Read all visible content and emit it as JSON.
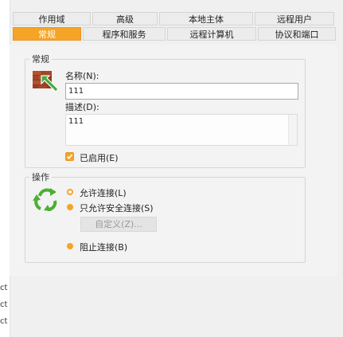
{
  "tabs_row1": [
    {
      "label": "作用域"
    },
    {
      "label": "高级"
    },
    {
      "label": "本地主体"
    },
    {
      "label": "远程用户"
    }
  ],
  "tabs_row2": [
    {
      "label": "常规",
      "active": true
    },
    {
      "label": "程序和服务"
    },
    {
      "label": "远程计算机"
    },
    {
      "label": "协议和端口"
    }
  ],
  "general": {
    "legend": "常规",
    "icon": "firewall-brick-icon",
    "name_label": "名称(N):",
    "name_value": "111",
    "description_label": "描述(D):",
    "description_value": "111",
    "enabled_label": "已启用(E)",
    "enabled_checked": true
  },
  "action": {
    "legend": "操作",
    "icon": "recycle-arrows-icon",
    "allow_label": "允许连接(L)",
    "allow_secure_label": "只允许安全连接(S)",
    "customize_label": "自定义(Z)...",
    "block_label": "阻止连接(B)",
    "selected": "allow"
  },
  "left_strip_fragments": [
    "ct",
    "ct",
    "ct"
  ],
  "colors": {
    "accent": "#f5a425",
    "tab_bg": "#ececec",
    "page_bg": "#f0f0f0"
  }
}
